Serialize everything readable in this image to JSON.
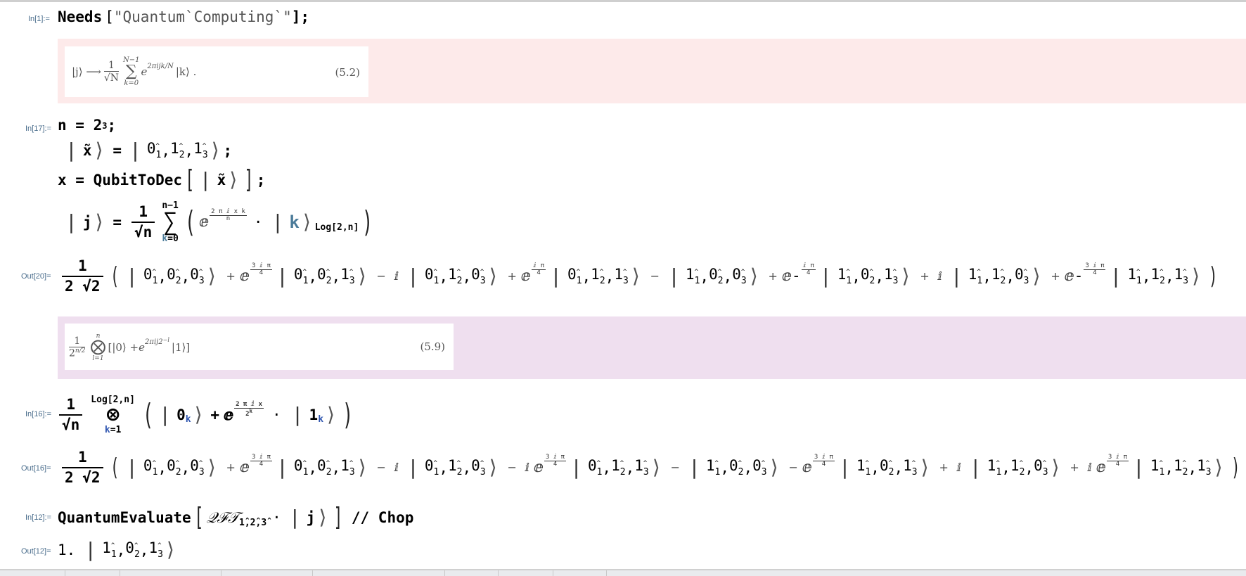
{
  "cells": {
    "in1": {
      "label": "In[1]:=",
      "func": "Needs",
      "open": "[",
      "string": "\"Quantum`Computing`\"",
      "close": "];"
    },
    "note1": {
      "formula_lhs": "|j⟩ ⟶",
      "formula_num": "1",
      "formula_den": "√N",
      "sum_upper": "N−1",
      "sum_lower": "k=0",
      "sum_symbol": "∑",
      "exponent_base": "e",
      "exponent": "2πijk/N",
      "ket": "|k⟩ .",
      "eq_number": "(5.2)",
      "band_color": "#fdeaea"
    },
    "in17": {
      "label": "In[17]:=",
      "line1": {
        "lhs": "n = 2",
        "sup": "3",
        "end": ";"
      },
      "line2": {
        "lhs": "x̃",
        "eq": "=",
        "qubits": [
          [
            "0",
            "1"
          ],
          [
            "1",
            "2"
          ],
          [
            "1",
            "3"
          ]
        ],
        "end": ";"
      },
      "line3": {
        "lhs": "x = QubitToDec",
        "arg": "x̃",
        "end": ";"
      },
      "line4": {
        "lhs": "j",
        "eq": "=",
        "num": "1",
        "den": "√n",
        "sum_upper": "n−1",
        "sum_lower_var": "k",
        "sum_lower_val": "=0",
        "exp_num": "2 π ⅈ x k",
        "exp_den": "n",
        "dot": "·",
        "ket_var": "k",
        "ket_sub": "Log[2,n]"
      }
    },
    "out20": {
      "label": "Out[20]=",
      "num": "1",
      "den": "2 √2",
      "terms": [
        {
          "sign": "",
          "coef": "",
          "exp_num": "",
          "exp_den": "",
          "neg": false,
          "qubits": [
            [
              "0",
              "1"
            ],
            [
              "0",
              "2"
            ],
            [
              "0",
              "3"
            ]
          ]
        },
        {
          "sign": "+",
          "coef": "",
          "exp_num": "3 ⅈ π",
          "exp_den": "4",
          "neg": false,
          "qubits": [
            [
              "0",
              "1"
            ],
            [
              "0",
              "2"
            ],
            [
              "1",
              "3"
            ]
          ]
        },
        {
          "sign": "−",
          "coef": "ⅈ",
          "exp_num": "",
          "exp_den": "",
          "neg": false,
          "qubits": [
            [
              "0",
              "1"
            ],
            [
              "1",
              "2"
            ],
            [
              "0",
              "3"
            ]
          ]
        },
        {
          "sign": "+",
          "coef": "",
          "exp_num": "ⅈ π",
          "exp_den": "4",
          "neg": false,
          "qubits": [
            [
              "0",
              "1"
            ],
            [
              "1",
              "2"
            ],
            [
              "1",
              "3"
            ]
          ]
        },
        {
          "sign": "−",
          "coef": "",
          "exp_num": "",
          "exp_den": "",
          "neg": false,
          "qubits": [
            [
              "1",
              "1"
            ],
            [
              "0",
              "2"
            ],
            [
              "0",
              "3"
            ]
          ]
        },
        {
          "sign": "+",
          "coef": "",
          "exp_num": "ⅈ π",
          "exp_den": "4",
          "neg": true,
          "qubits": [
            [
              "1",
              "1"
            ],
            [
              "0",
              "2"
            ],
            [
              "1",
              "3"
            ]
          ]
        },
        {
          "sign": "+",
          "coef": "ⅈ",
          "exp_num": "",
          "exp_den": "",
          "neg": false,
          "qubits": [
            [
              "1",
              "1"
            ],
            [
              "1",
              "2"
            ],
            [
              "0",
              "3"
            ]
          ]
        },
        {
          "sign": "+",
          "coef": "",
          "exp_num": "3 ⅈ π",
          "exp_den": "4",
          "neg": true,
          "qubits": [
            [
              "1",
              "1"
            ],
            [
              "1",
              "2"
            ],
            [
              "1",
              "3"
            ]
          ]
        }
      ]
    },
    "note2": {
      "num": "1",
      "den": "2",
      "den_sup": "n/2",
      "tensor_upper": "n",
      "tensor_lower": "l=1",
      "tensor_symbol": "⨂",
      "body_open": "[|0⟩ + ",
      "exponent_base": "e",
      "exponent": "2πij2",
      "exponent_sup": "−l",
      "body_close": "|1⟩]",
      "eq_number": "(5.9)",
      "band_color": "#efdfef"
    },
    "in16": {
      "label": "In[16]:=",
      "num": "1",
      "den": "√n",
      "tensor_upper": "Log[2,n]",
      "tensor_symbol": "⊗",
      "tensor_lower_var": "k",
      "tensor_lower_val": "=1",
      "ket0": "0",
      "ket0_sub": "k",
      "plus": "+",
      "exp_num": "2 π ⅈ x",
      "exp_den_base": "2",
      "exp_den_sup": "k",
      "dot": "·",
      "ket1": "1",
      "ket1_sub": "k"
    },
    "out16": {
      "label": "Out[16]=",
      "num": "1",
      "den": "2 √2",
      "terms": [
        {
          "sign": "",
          "coef": "",
          "exp_num": "",
          "exp_den": "",
          "qubits": [
            [
              "0",
              "1"
            ],
            [
              "0",
              "2"
            ],
            [
              "0",
              "3"
            ]
          ]
        },
        {
          "sign": "+",
          "coef": "",
          "exp_num": "3 ⅈ π",
          "exp_den": "4",
          "qubits": [
            [
              "0",
              "1"
            ],
            [
              "0",
              "2"
            ],
            [
              "1",
              "3"
            ]
          ]
        },
        {
          "sign": "−",
          "coef": "ⅈ",
          "exp_num": "",
          "exp_den": "",
          "qubits": [
            [
              "0",
              "1"
            ],
            [
              "1",
              "2"
            ],
            [
              "0",
              "3"
            ]
          ]
        },
        {
          "sign": "−",
          "coef": "ⅈ",
          "exp_num": "3 ⅈ π",
          "exp_den": "4",
          "qubits": [
            [
              "0",
              "1"
            ],
            [
              "1",
              "2"
            ],
            [
              "1",
              "3"
            ]
          ]
        },
        {
          "sign": "−",
          "coef": "",
          "exp_num": "",
          "exp_den": "",
          "qubits": [
            [
              "1",
              "1"
            ],
            [
              "0",
              "2"
            ],
            [
              "0",
              "3"
            ]
          ]
        },
        {
          "sign": "−",
          "coef": "",
          "exp_num": "3 ⅈ π",
          "exp_den": "4",
          "qubits": [
            [
              "1",
              "1"
            ],
            [
              "0",
              "2"
            ],
            [
              "1",
              "3"
            ]
          ]
        },
        {
          "sign": "+",
          "coef": "ⅈ",
          "exp_num": "",
          "exp_den": "",
          "qubits": [
            [
              "1",
              "1"
            ],
            [
              "1",
              "2"
            ],
            [
              "0",
              "3"
            ]
          ]
        },
        {
          "sign": "+",
          "coef": "ⅈ",
          "exp_num": "3 ⅈ π",
          "exp_den": "4",
          "qubits": [
            [
              "1",
              "1"
            ],
            [
              "1",
              "2"
            ],
            [
              "1",
              "3"
            ]
          ]
        }
      ]
    },
    "in12": {
      "label": "In[12]:=",
      "func": "QuantumEvaluate",
      "op": "𝒬ℱ𝒯",
      "op_sub": "1̂,2̂,3̂",
      "dot": "·",
      "ket": "j",
      "postfix": "// Chop"
    },
    "out12": {
      "label": "Out[12]=",
      "coef": "1.",
      "qubits": [
        [
          "1",
          "1"
        ],
        [
          "0",
          "2"
        ],
        [
          "1",
          "3"
        ]
      ]
    }
  }
}
